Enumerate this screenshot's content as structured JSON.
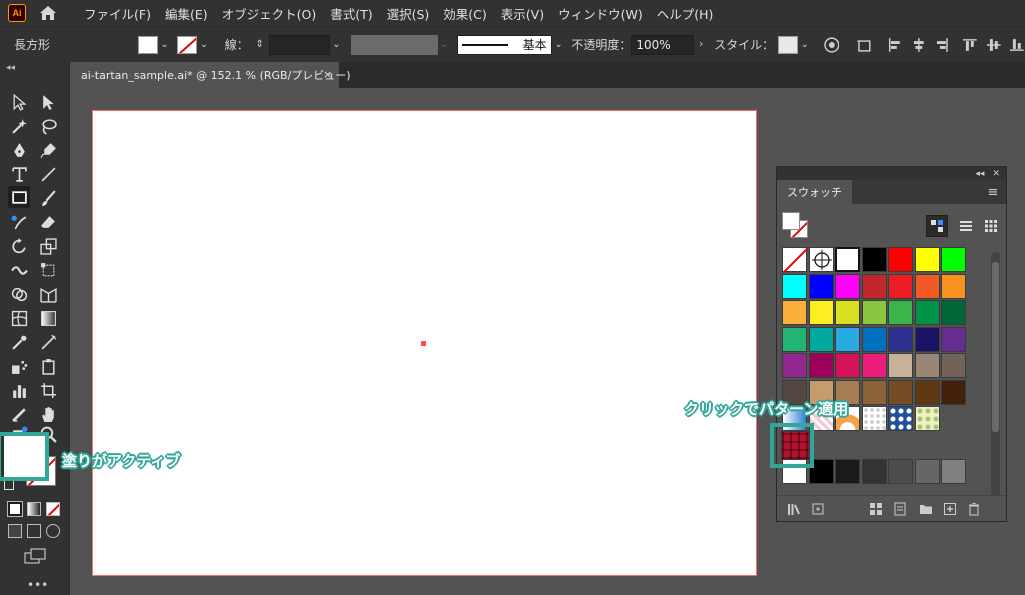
{
  "app": {
    "logo_text": "Ai"
  },
  "menu": [
    "ファイル(F)",
    "編集(E)",
    "オブジェクト(O)",
    "書式(T)",
    "選択(S)",
    "効果(C)",
    "表示(V)",
    "ウィンドウ(W)",
    "ヘルプ(H)"
  ],
  "control": {
    "object_type": "長方形",
    "stroke_label": "線：",
    "stroke_style": "基本",
    "opacity_label": "不透明度：",
    "opacity_value": "100%",
    "style_label": "スタイル："
  },
  "document": {
    "tab_title": "ai-tartan_sample.ai* @ 152.1 % (RGB/プレビュー)",
    "close": "×"
  },
  "swatches": {
    "panel_title": "スウォッチ",
    "rows": [
      [
        "none",
        "registration",
        "#ffffff",
        "#000000",
        "#ff0000",
        "#ffff00",
        "#00ff00"
      ],
      [
        "#00ffff",
        "#0000ff",
        "#ff00ff",
        "#c1272d",
        "#ed1c24",
        "#f15a24",
        "#f7931e"
      ],
      [
        "#fbb03b",
        "#fcee21",
        "#d9e021",
        "#8cc63f",
        "#39b54a",
        "#009245",
        "#006837"
      ],
      [
        "#22b573",
        "#00a99d",
        "#29abe2",
        "#0071bc",
        "#2e3192",
        "#1b1464",
        "#662d91"
      ],
      [
        "#93278f",
        "#9e005d",
        "#d4145a",
        "#ed1e79",
        "#c7b299",
        "#998675",
        "#736357"
      ],
      [
        "#534741",
        "#c69c6d",
        "#a67c52",
        "#8c6239",
        "#754c24",
        "#603813",
        "#42210b"
      ],
      [
        "pattern-gradient-blue",
        "pattern-pink",
        "pattern-orange",
        "pattern-dots",
        "pattern-blue-floral",
        "pattern-yellow"
      ],
      [
        "pattern-tartan"
      ],
      [
        "#ffffff",
        "#000000",
        "#1a1a1a",
        "#333333",
        "#4d4d4d",
        "#666666",
        "#808080"
      ]
    ]
  },
  "annotations": {
    "pattern_hint": "クリックでパターン適用",
    "fill_hint": "塗りがアクティブ"
  },
  "colors": {
    "accent_teal": "#33a69a",
    "ui_dark": "#323232",
    "ui_mid": "#535353"
  }
}
